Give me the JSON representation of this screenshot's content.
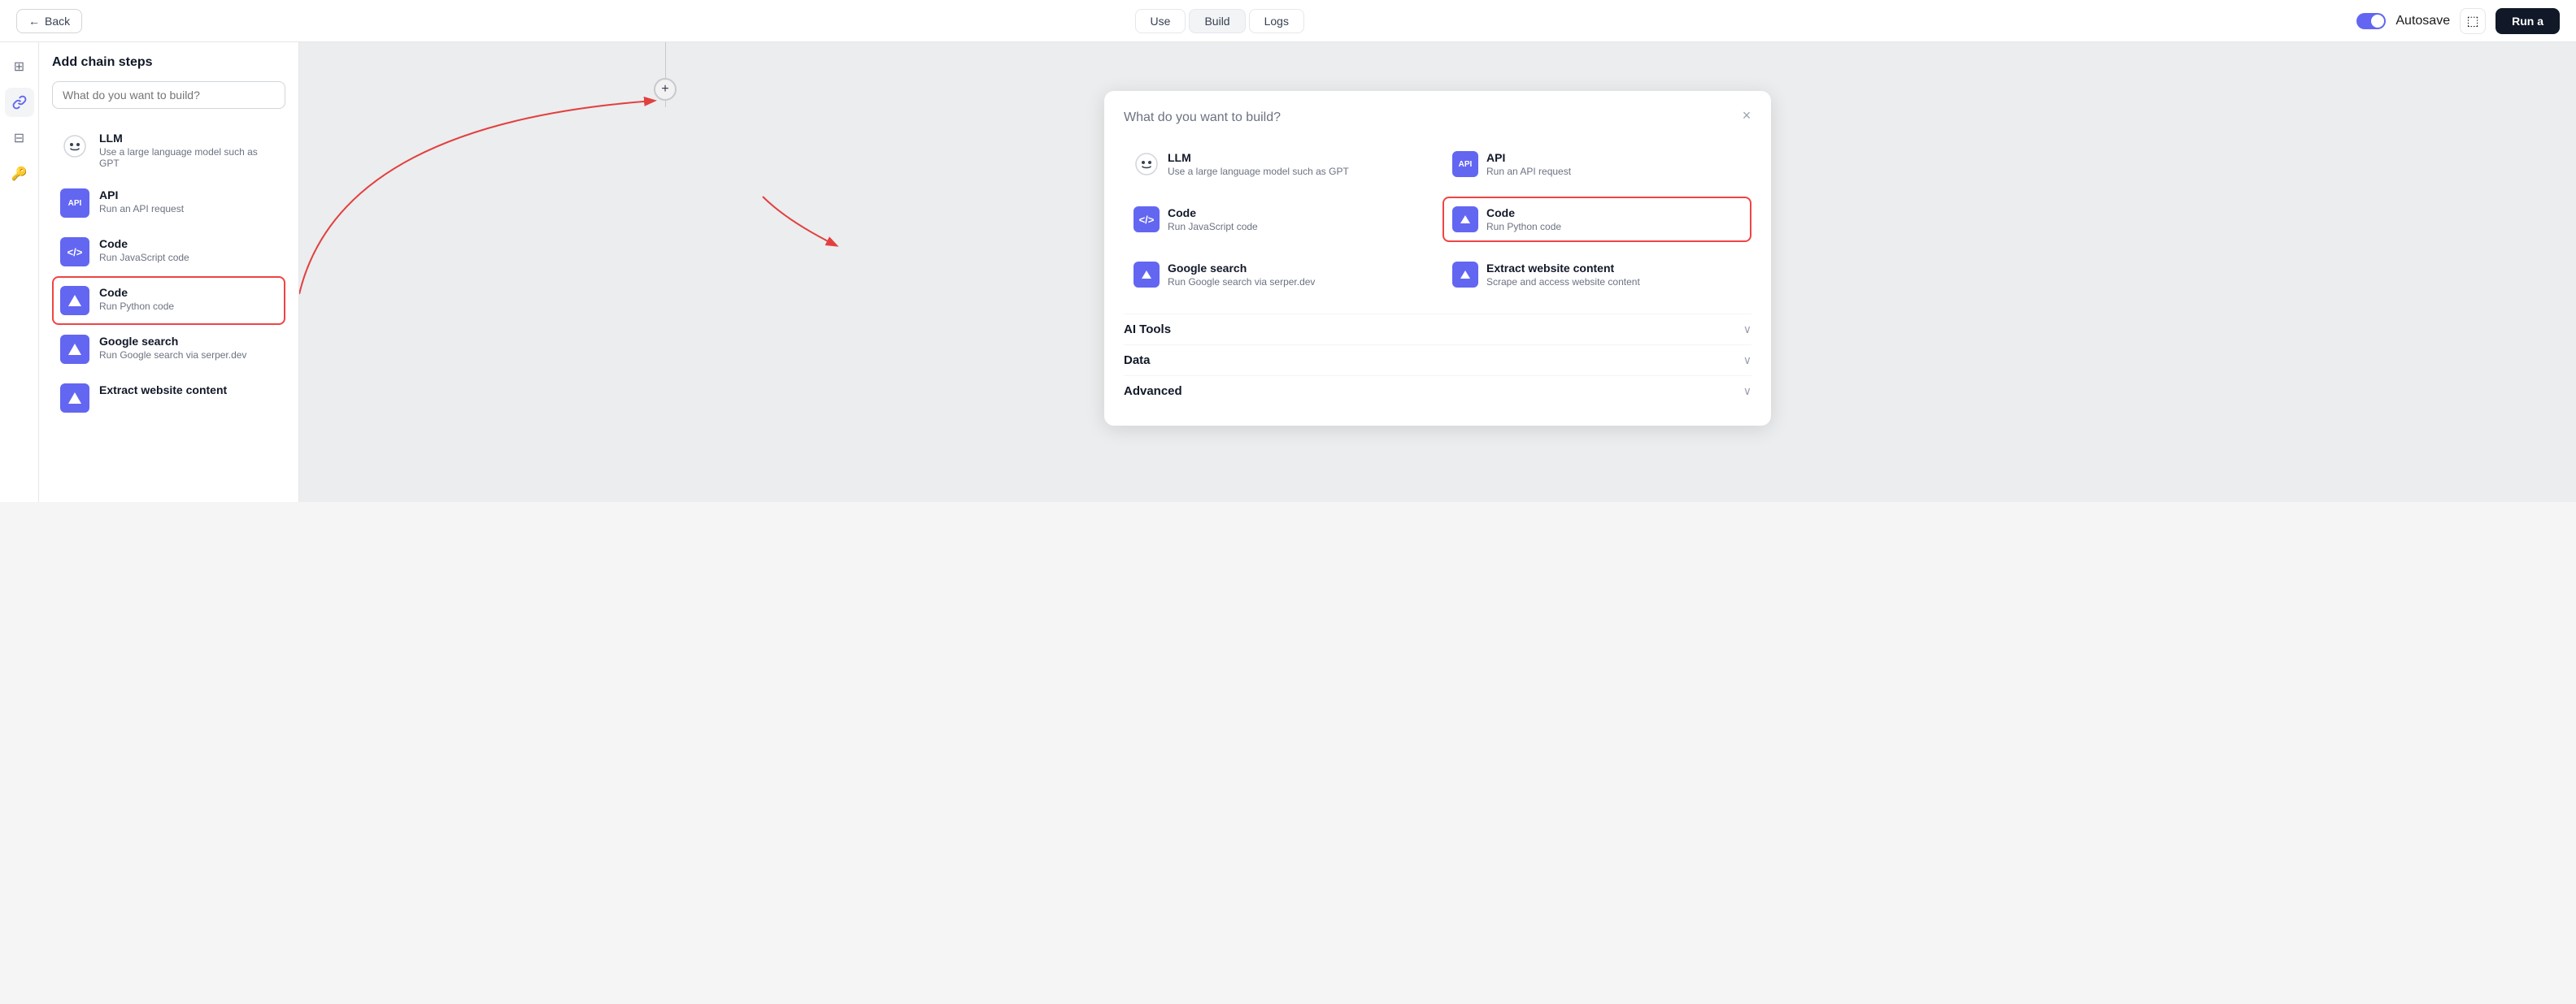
{
  "header": {
    "back_label": "Back",
    "tabs": [
      "Use",
      "Build",
      "Logs"
    ],
    "active_tab": "Build",
    "autosave_label": "Autosave",
    "run_label": "Run a"
  },
  "sidebar": {
    "icons": [
      {
        "name": "grid-icon",
        "symbol": "⊞"
      },
      {
        "name": "link-icon",
        "symbol": "🔗"
      },
      {
        "name": "widget-icon",
        "symbol": "⊟"
      },
      {
        "name": "key-icon",
        "symbol": "🔑"
      }
    ]
  },
  "left_panel": {
    "title": "Add chain steps",
    "search_placeholder": "What do you want to build?",
    "items": [
      {
        "id": "llm",
        "name": "LLM",
        "desc": "Use a large language model such as GPT",
        "icon_type": "llm"
      },
      {
        "id": "api",
        "name": "API",
        "desc": "Run an API request",
        "icon_type": "api"
      },
      {
        "id": "code-js",
        "name": "Code",
        "desc": "Run JavaScript code",
        "icon_type": "code-js"
      },
      {
        "id": "code-py",
        "name": "Code",
        "desc": "Run Python code",
        "icon_type": "code-py",
        "selected": true
      },
      {
        "id": "google",
        "name": "Google search",
        "desc": "Run Google search via serper.dev",
        "icon_type": "google"
      },
      {
        "id": "extract",
        "name": "Extract website content",
        "desc": "",
        "icon_type": "extract"
      }
    ]
  },
  "canvas": {
    "plus_symbol": "+"
  },
  "modal": {
    "title": "What do you want to build?",
    "close_symbol": "×",
    "items": [
      {
        "id": "llm",
        "name": "LLM",
        "desc": "Use a large language model such as GPT",
        "icon_type": "llm",
        "col": 0
      },
      {
        "id": "api",
        "name": "API",
        "desc": "Run an API request",
        "icon_type": "api",
        "col": 1
      },
      {
        "id": "code-js",
        "name": "Code",
        "desc": "Run JavaScript code",
        "icon_type": "code-js",
        "col": 0
      },
      {
        "id": "code-py",
        "name": "Code",
        "desc": "Run Python code",
        "icon_type": "code-py",
        "col": 1,
        "selected": true
      },
      {
        "id": "google",
        "name": "Google search",
        "desc": "Run Google search via serper.dev",
        "icon_type": "google",
        "col": 0
      },
      {
        "id": "extract",
        "name": "Extract website content",
        "desc": "Scrape and access website content",
        "icon_type": "extract",
        "col": 1
      }
    ],
    "sections": [
      {
        "label": "AI Tools"
      },
      {
        "label": "Data"
      },
      {
        "label": "Advanced"
      }
    ]
  }
}
